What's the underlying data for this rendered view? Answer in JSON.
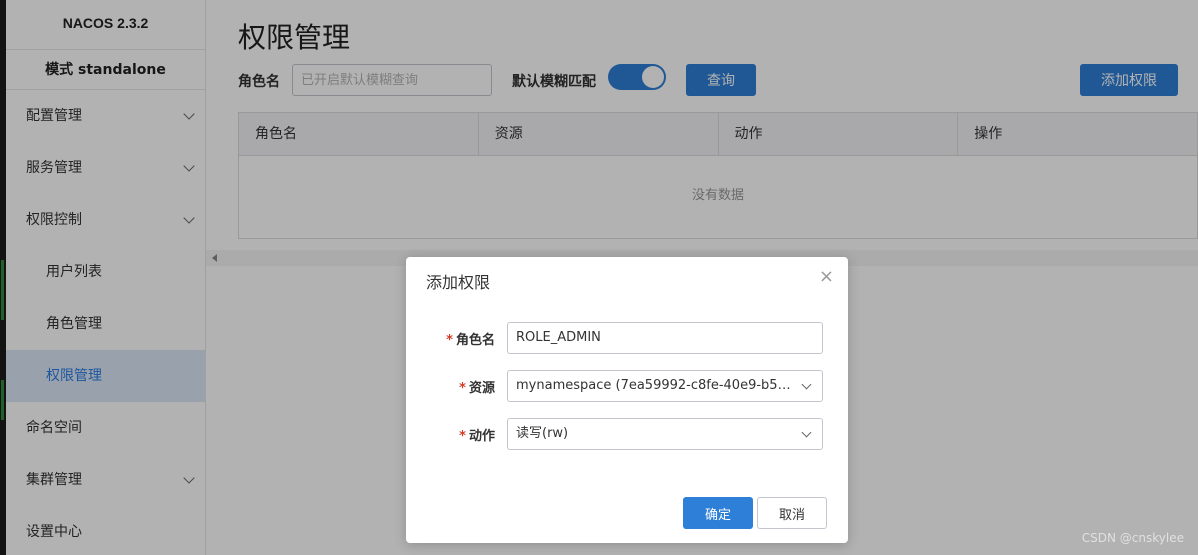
{
  "sidebar": {
    "brand": "NACOS 2.3.2",
    "mode": "模式 standalone",
    "items": [
      {
        "label": "配置管理",
        "has_children": true
      },
      {
        "label": "服务管理",
        "has_children": true
      },
      {
        "label": "权限控制",
        "has_children": true
      },
      {
        "label": "用户列表"
      },
      {
        "label": "角色管理"
      },
      {
        "label": "权限管理",
        "active": true
      },
      {
        "label": "命名空间"
      },
      {
        "label": "集群管理",
        "has_children": true
      },
      {
        "label": "设置中心"
      }
    ]
  },
  "main": {
    "title": "权限管理",
    "filter": {
      "role_label": "角色名",
      "role_placeholder": "已开启默认模糊查询",
      "fuzzy_label": "默认模糊匹配",
      "fuzzy_on": true,
      "query_button": "查询",
      "add_button": "添加权限"
    },
    "table": {
      "columns": [
        "角色名",
        "资源",
        "动作",
        "操作"
      ],
      "empty_text": "没有数据"
    }
  },
  "dialog": {
    "title": "添加权限",
    "close_icon": "×",
    "fields": {
      "role": {
        "label": "角色名",
        "value": "ROLE_ADMIN"
      },
      "resource": {
        "label": "资源",
        "value": "mynamespace (7ea59992-c8fe-40e9-b5be..."
      },
      "action": {
        "label": "动作",
        "value": "读写(rw)"
      }
    },
    "ok_button": "确定",
    "cancel_button": "取消"
  },
  "watermark": "CSDN @cnskylee",
  "colors": {
    "primary": "#2e7fd7",
    "active_bg": "#dbe9f7",
    "required": "#d23c26"
  }
}
